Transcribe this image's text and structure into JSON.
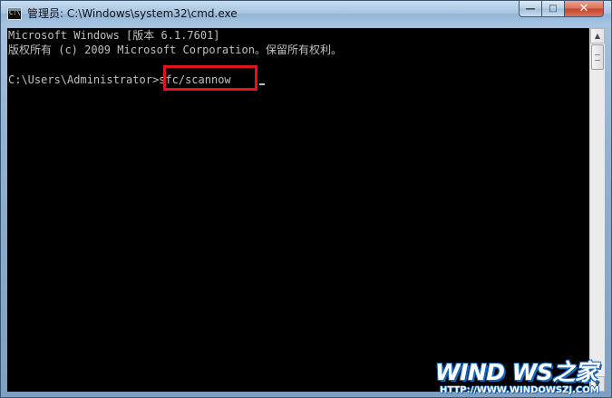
{
  "window": {
    "title": "管理员: C:\\Windows\\system32\\cmd.exe",
    "icon": "cmd-icon",
    "icon_glyph": "C:\\",
    "buttons": {
      "minimize": "—",
      "maximize": "□",
      "close": "✕"
    }
  },
  "console": {
    "lines": [
      "Microsoft Windows [版本 6.1.7601]",
      "版权所有 (c) 2009 Microsoft Corporation。保留所有权利。",
      "C:\\Users\\Administrator>sfc/scannow"
    ],
    "highlight_color": "#e5121f",
    "text_color": "#c0c0c0",
    "background": "#000000"
  },
  "scrollbar": {
    "up_glyph": "▲",
    "down_glyph": "▼"
  },
  "watermark": {
    "main": "WIND WS之家",
    "url": "HTTP://WWW.WINDOWSZJ.COM"
  }
}
